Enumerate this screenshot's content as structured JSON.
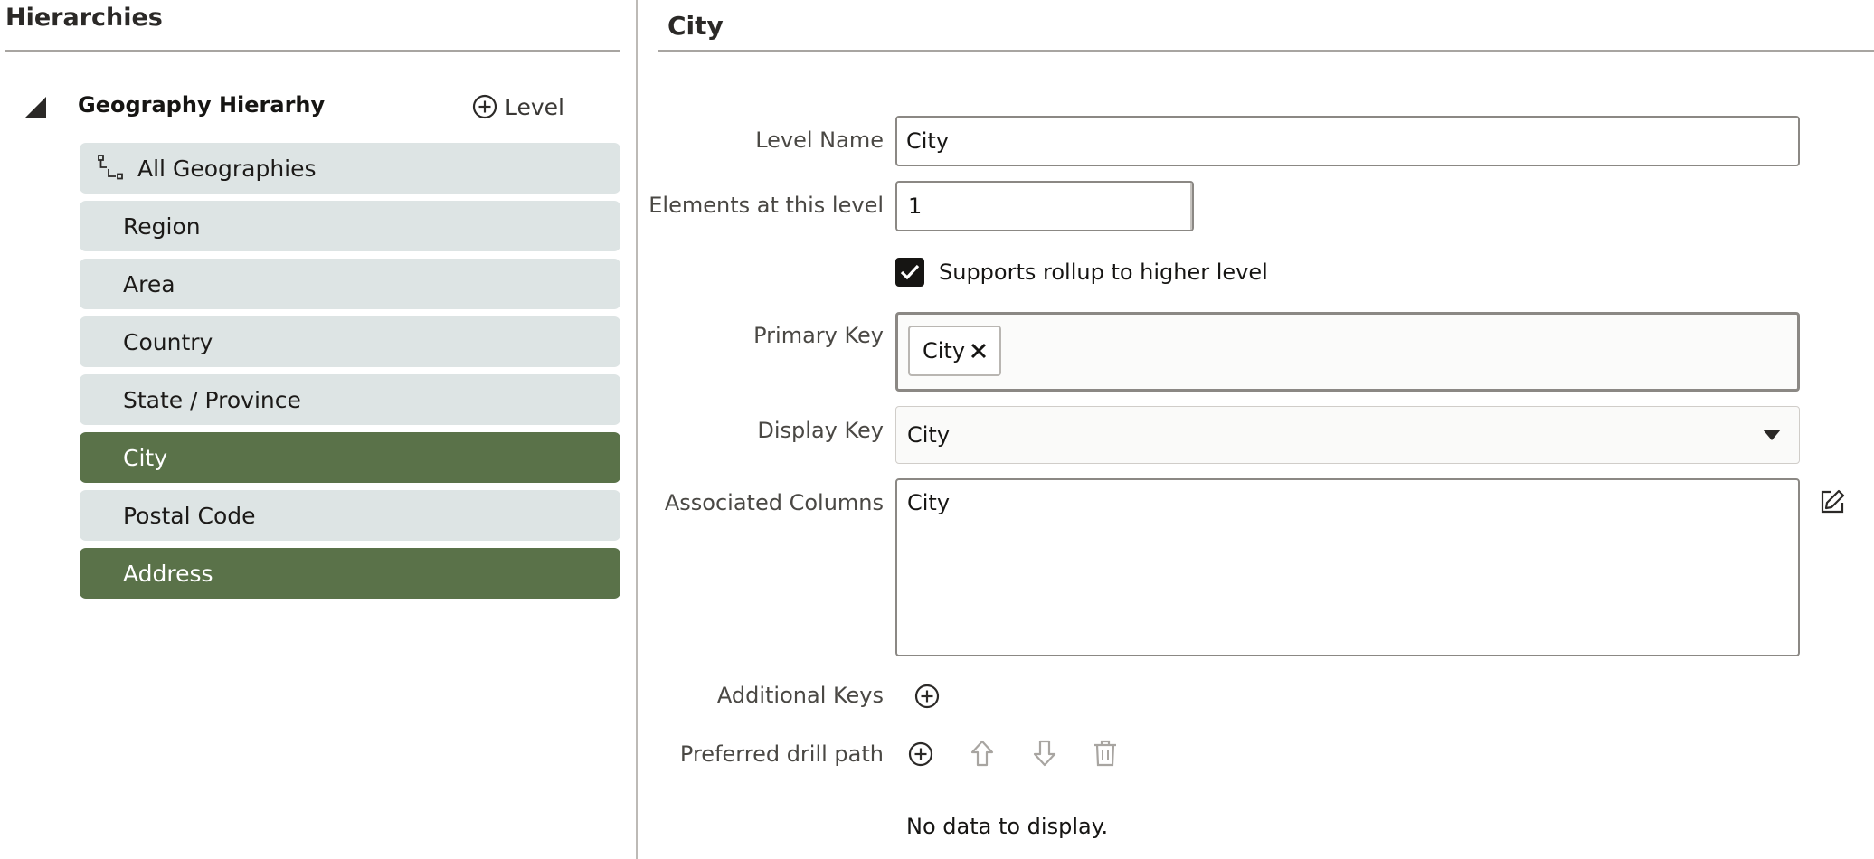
{
  "hierarchies": {
    "title": "Hierarchies",
    "hierarchy": {
      "name": "Geography Hierarhy",
      "add_level_label": "Level",
      "levels": [
        {
          "label": "All Geographies",
          "selected": false
        },
        {
          "label": "Region",
          "selected": false
        },
        {
          "label": "Area",
          "selected": false
        },
        {
          "label": "Country",
          "selected": false
        },
        {
          "label": "State / Province",
          "selected": false
        },
        {
          "label": "City",
          "selected": true
        },
        {
          "label": "Postal Code",
          "selected": false
        },
        {
          "label": "Address",
          "selected": true
        }
      ]
    }
  },
  "detail": {
    "title": "City",
    "level_name": {
      "label": "Level Name",
      "value": "City"
    },
    "elements": {
      "label": "Elements at this level",
      "value": "1"
    },
    "rollup": {
      "label": "Supports rollup to higher level",
      "checked": true
    },
    "primary_key": {
      "label": "Primary Key",
      "chips": [
        "City"
      ]
    },
    "display_key": {
      "label": "Display Key",
      "value": "City"
    },
    "associated_columns": {
      "label": "Associated Columns",
      "value": "City"
    },
    "additional_keys": {
      "label": "Additional Keys"
    },
    "drill_path": {
      "label": "Preferred drill path",
      "empty_message": "No data to display."
    }
  },
  "colors": {
    "selected_level": "#5a7249",
    "level_background": "#dde4e4"
  }
}
